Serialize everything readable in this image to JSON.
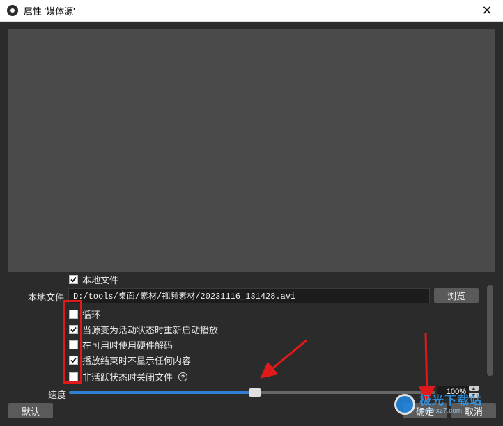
{
  "window": {
    "title": "属性 '媒体源'",
    "close": "✕"
  },
  "props": {
    "local_file_checkbox": "本地文件",
    "local_file_label": "本地文件",
    "local_file_path": "D:/tools/桌面/素材/视频素材/20231116_131428.avi",
    "browse": "浏览",
    "options": [
      {
        "label": "循环",
        "checked": false
      },
      {
        "label": "当源变为活动状态时重新启动播放",
        "checked": true
      },
      {
        "label": "在可用时使用硬件解码",
        "checked": false
      },
      {
        "label": "播放结束时不显示任何内容",
        "checked": true
      },
      {
        "label": "非活跃状态时关闭文件",
        "checked": false
      }
    ],
    "help": "?",
    "speed_label": "速度",
    "speed_value": "100%",
    "speed_fraction": 0.49
  },
  "footer": {
    "defaults": "默认",
    "ok": "确定",
    "cancel": "取消"
  },
  "watermark": {
    "big": "极光下载站",
    "small": "www.xz7.com"
  },
  "colors": {
    "accent": "#2f7fd6",
    "annotation": "#e01a1a"
  }
}
